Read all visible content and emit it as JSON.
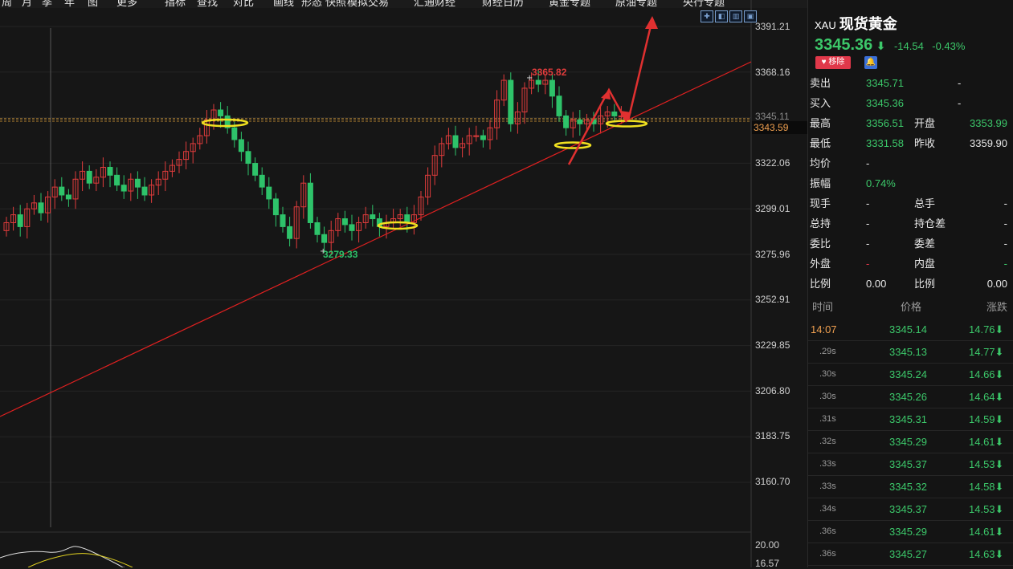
{
  "toolbar": {
    "items": [
      "周",
      "月",
      "季",
      "年",
      "图",
      "更多",
      "指标",
      "查找",
      "对比",
      "画线",
      "形态",
      "快照",
      "模拟交易",
      "汇通财经",
      "财经日历",
      "黄金专题",
      "原油专题",
      "央行专题"
    ]
  },
  "chart_data": {
    "type": "candlestick",
    "price_axis": [
      "3391.21",
      "3368.16",
      "3345.11",
      "3322.06",
      "3299.01",
      "3275.96",
      "3252.91",
      "3229.85",
      "3206.80",
      "3183.75",
      "3160.70"
    ],
    "indicator_axis": [
      "20.00",
      "16.57"
    ],
    "current_price_label": "3343.59",
    "high_label": "3365.82",
    "low_label": "3279.33",
    "colors": {
      "up": "#e03c3c",
      "down": "#2ec36a",
      "trend": "#e02020",
      "marker": "#f0e020"
    }
  },
  "panel": {
    "symbol": "XAU",
    "name": "现货黄金",
    "last": "3345.36",
    "arrow": "⬇",
    "change": "-14.54",
    "change_pct": "-0.43%",
    "fav_label": "移除",
    "quotes": [
      {
        "l1": "卖出",
        "v1": "3345.71",
        "v1c": "grn",
        "v1b": "-",
        "l2": "",
        "v2": "",
        "v2c": "wht"
      },
      {
        "l1": "买入",
        "v1": "3345.36",
        "v1c": "grn",
        "v1b": "-",
        "l2": "",
        "v2": "",
        "v2c": "wht"
      },
      {
        "l1": "最高",
        "v1": "3356.51",
        "v1c": "grn",
        "v1b": "",
        "l2": "开盘",
        "v2": "3353.99",
        "v2c": "grn"
      },
      {
        "l1": "最低",
        "v1": "3331.58",
        "v1c": "grn",
        "v1b": "",
        "l2": "昨收",
        "v2": "3359.90",
        "v2c": "wht"
      },
      {
        "l1": "均价",
        "v1": "-",
        "v1c": "wht",
        "v1b": "",
        "l2": "",
        "v2": "",
        "v2c": "wht"
      },
      {
        "l1": "振幅",
        "v1": "0.74%",
        "v1c": "grn",
        "v1b": "",
        "l2": "",
        "v2": "",
        "v2c": "wht"
      },
      {
        "l1": "现手",
        "v1": "-",
        "v1c": "wht",
        "v1b": "",
        "l2": "总手",
        "v2": "-",
        "v2c": "wht"
      },
      {
        "l1": "总持",
        "v1": "-",
        "v1c": "wht",
        "v1b": "",
        "l2": "持仓差",
        "v2": "-",
        "v2c": "wht"
      },
      {
        "l1": "委比",
        "v1": "-",
        "v1c": "wht",
        "v1b": "",
        "l2": "委差",
        "v2": "-",
        "v2c": "wht"
      },
      {
        "l1": "外盘",
        "v1": "-",
        "v1c": "red",
        "v1b": "",
        "l2": "内盘",
        "v2": "-",
        "v2c": "grn"
      },
      {
        "l1": "比例",
        "v1": "0.00",
        "v1c": "wht",
        "v1b": "",
        "l2": "比例",
        "v2": "0.00",
        "v2c": "wht"
      }
    ],
    "tick_headers": [
      "时间",
      "价格",
      "涨跌"
    ],
    "ticks": [
      {
        "time": "14:07",
        "price": "3345.14",
        "chg": "14.76⬇"
      },
      {
        "time": ".29s",
        "price": "3345.13",
        "chg": "14.77⬇"
      },
      {
        "time": ".30s",
        "price": "3345.24",
        "chg": "14.66⬇"
      },
      {
        "time": ".30s",
        "price": "3345.26",
        "chg": "14.64⬇"
      },
      {
        "time": ".31s",
        "price": "3345.31",
        "chg": "14.59⬇"
      },
      {
        "time": ".32s",
        "price": "3345.29",
        "chg": "14.61⬇"
      },
      {
        "time": ".33s",
        "price": "3345.37",
        "chg": "14.53⬇"
      },
      {
        "time": ".33s",
        "price": "3345.32",
        "chg": "14.58⬇"
      },
      {
        "time": ".34s",
        "price": "3345.37",
        "chg": "14.53⬇"
      },
      {
        "time": ".36s",
        "price": "3345.29",
        "chg": "14.61⬇"
      },
      {
        "time": ".36s",
        "price": "3345.27",
        "chg": "14.63⬇"
      }
    ]
  }
}
